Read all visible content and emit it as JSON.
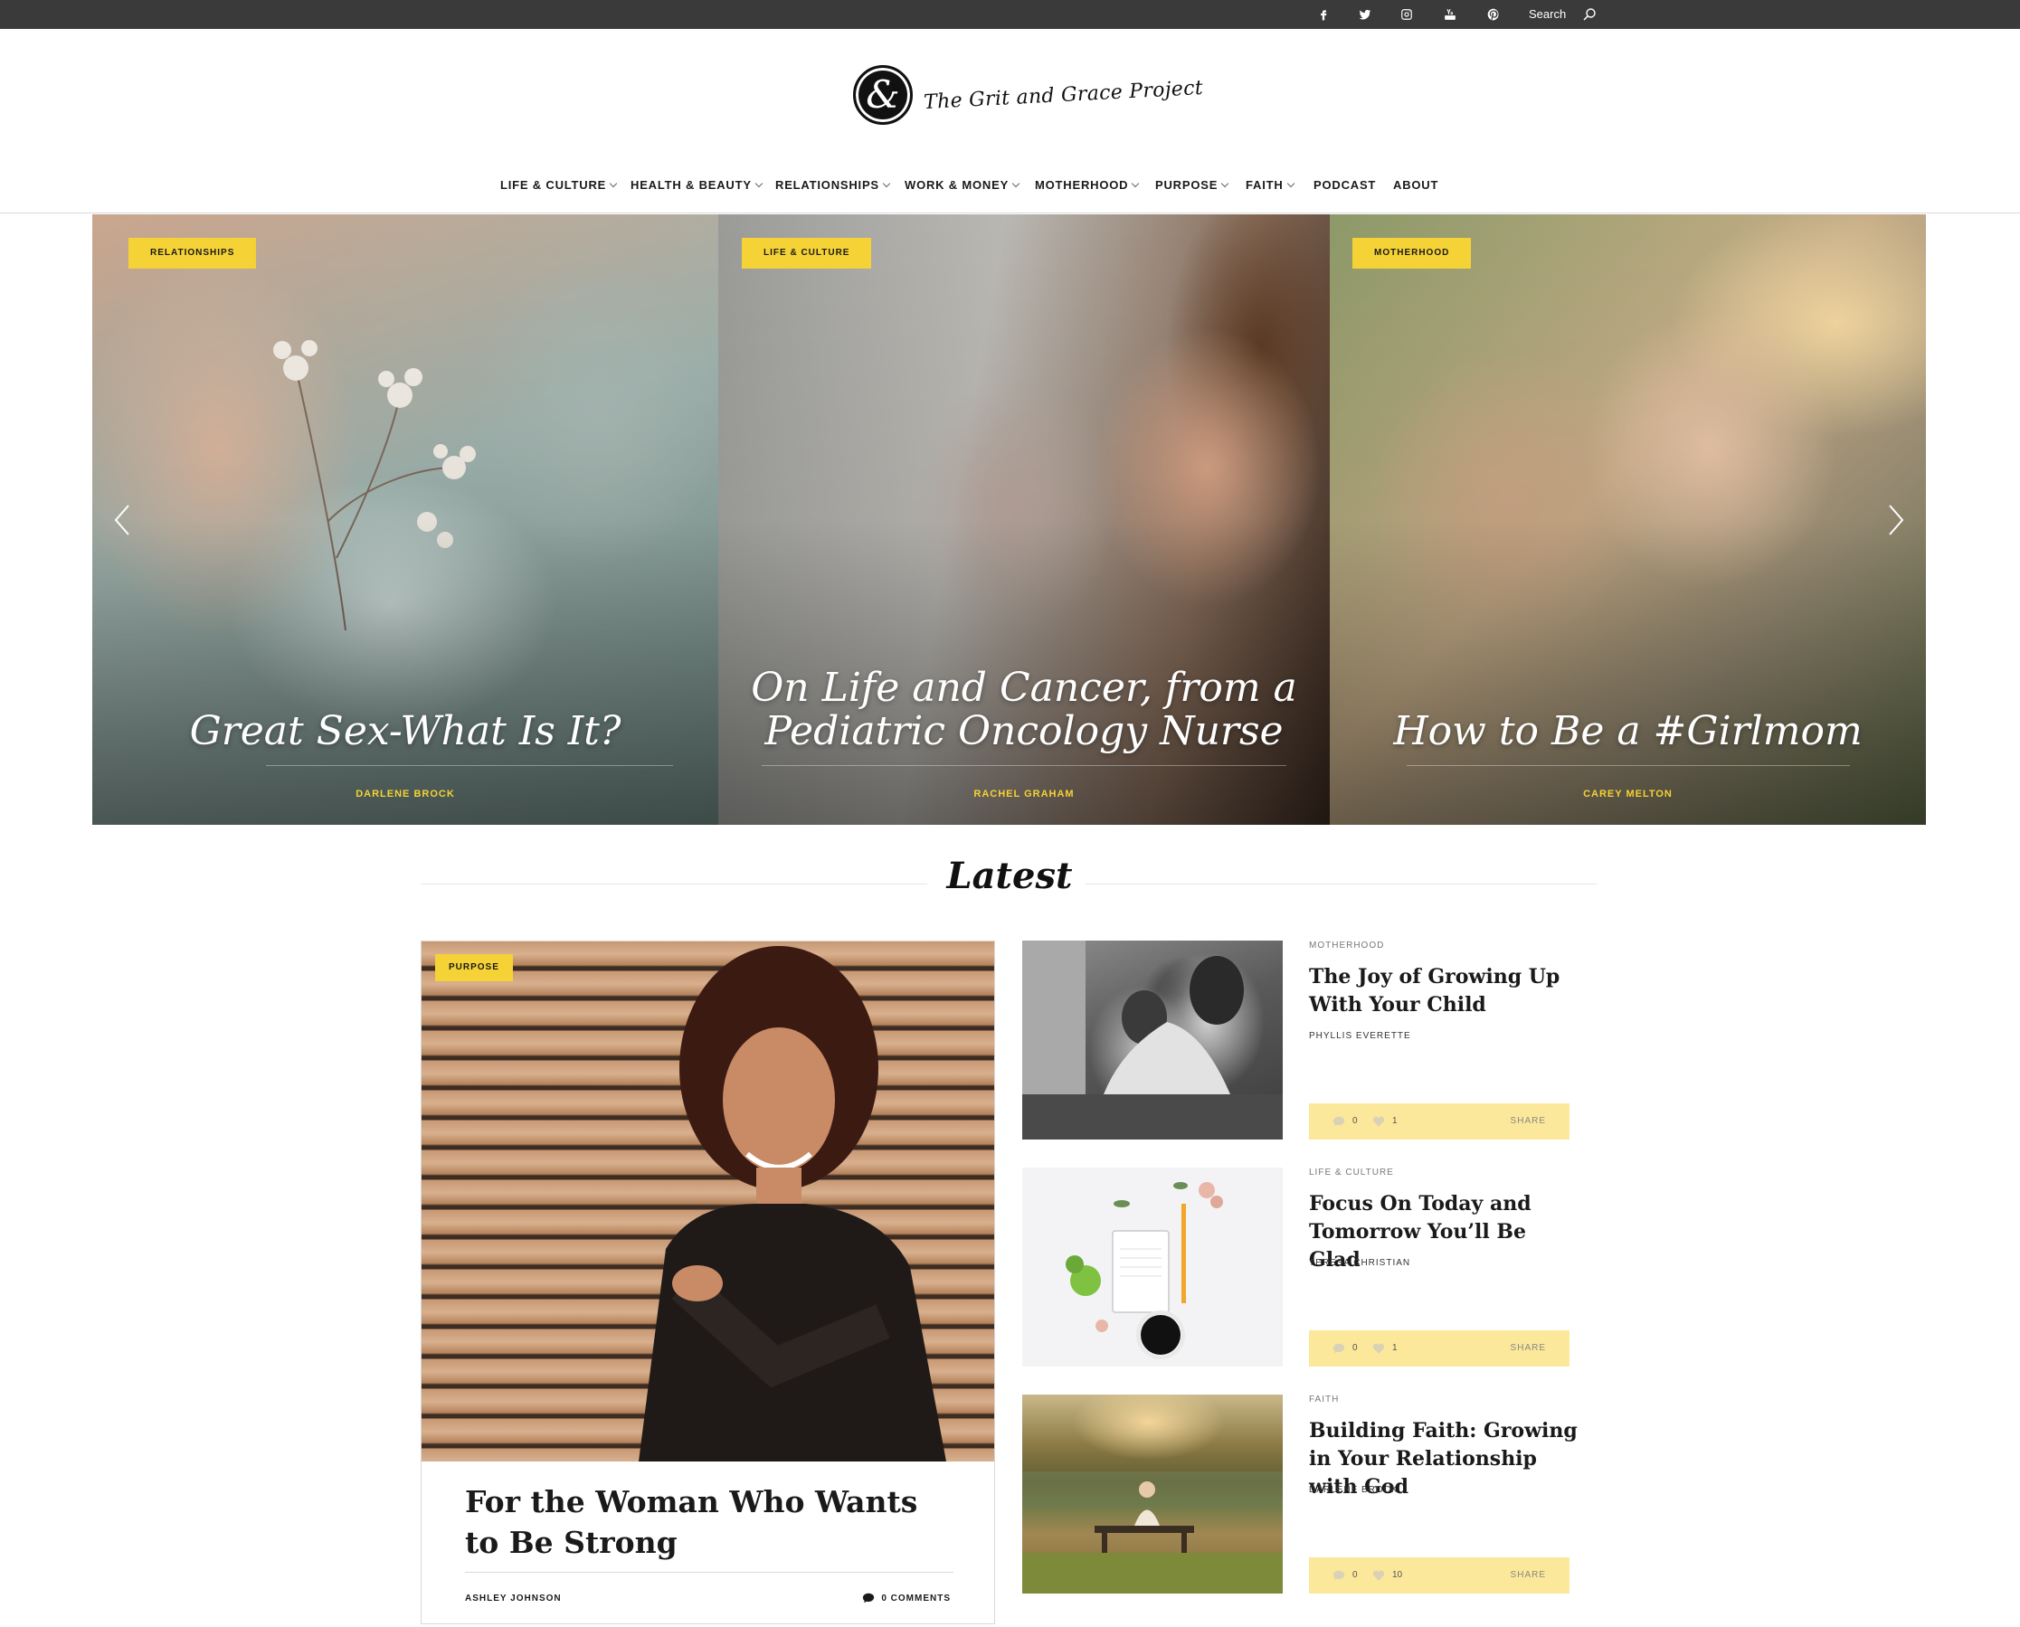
{
  "topbar": {
    "social": [
      "facebook",
      "twitter",
      "instagram",
      "youtube",
      "pinterest"
    ],
    "search_label": "Search"
  },
  "logo": {
    "mark": "&",
    "text": "The Grit and Grace Project"
  },
  "nav": [
    {
      "label": "LIFE & CULTURE",
      "dropdown": true
    },
    {
      "label": "HEALTH & BEAUTY",
      "dropdown": true
    },
    {
      "label": "RELATIONSHIPS",
      "dropdown": true
    },
    {
      "label": "WORK & MONEY",
      "dropdown": true
    },
    {
      "label": "MOTHERHOOD",
      "dropdown": true
    },
    {
      "label": "PURPOSE",
      "dropdown": true
    },
    {
      "label": "FAITH",
      "dropdown": true
    },
    {
      "label": "PODCAST",
      "dropdown": false
    },
    {
      "label": "ABOUT",
      "dropdown": false
    }
  ],
  "hero": {
    "slides": [
      {
        "tag": "RELATIONSHIPS",
        "title": "Great Sex-What Is It?",
        "author": "DARLENE BROCK"
      },
      {
        "tag": "LIFE & CULTURE",
        "title_line1": "On Life and Cancer, from a",
        "title_line2": "Pediatric Oncology Nurse",
        "author": "RACHEL GRAHAM"
      },
      {
        "tag": "MOTHERHOOD",
        "title": "How to Be a #Girlmom",
        "author": "CAREY MELTON"
      }
    ]
  },
  "latest": {
    "heading": "Latest",
    "featured": {
      "tag": "PURPOSE",
      "title": "For the Woman Who Wants to Be Strong",
      "author": "ASHLEY JOHNSON",
      "comments": "0 COMMENTS"
    },
    "articles": [
      {
        "category": "MOTHERHOOD",
        "title": "The Joy of Growing Up With Your Child",
        "author": "PHYLLIS EVERETTE",
        "comments": "0",
        "likes": "1",
        "share": "SHARE"
      },
      {
        "category": "LIFE & CULTURE",
        "title": "Focus On Today and Tomorrow You’ll Be Glad",
        "author": "TERESA CHRISTIAN",
        "comments": "0",
        "likes": "1",
        "share": "SHARE"
      },
      {
        "category": "FAITH",
        "title": "Building Faith: Growing in Your Relationship with God",
        "author": "DARLENE BROCK",
        "comments": "0",
        "likes": "10",
        "share": "SHARE"
      }
    ]
  },
  "colors": {
    "accent": "#f5d235",
    "meta_bar": "#fbe89a",
    "topbar": "#3a3a3a"
  }
}
